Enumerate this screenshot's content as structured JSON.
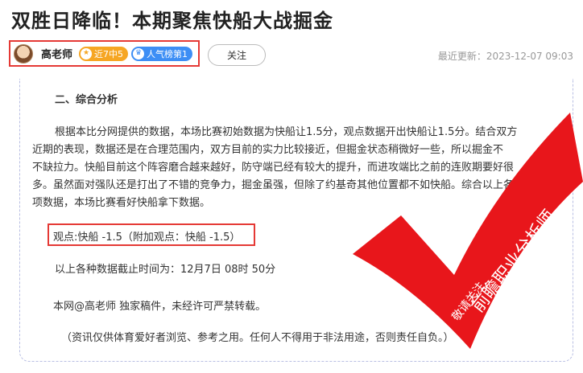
{
  "article": {
    "title": "双胜日降临！本期聚焦快船大战掘金",
    "update_time": "最近更新：2023-12-07 09:03"
  },
  "author": {
    "name": "高老师",
    "badges": [
      {
        "label": "近7中5",
        "icon": "star-icon",
        "color": "#f6a623"
      },
      {
        "label": "人气榜第1",
        "icon": "crown-icon",
        "color": "#3d8ef5"
      }
    ],
    "follow_label": "关注"
  },
  "content": {
    "section_heading": "二、综合分析",
    "paragraph_lines": [
      "根据本比分网提供的数据，本场比赛初始数据为快船让1.5分，观点数据开出快船让1.5分。结合双方",
      "近期的表现，数据还是在合理范围内，双方目前的实力比较接近，但掘金状态稍微好一些，所以掘金不",
      "不缺拉力。快船目前这个阵容磨合越来越好，防守端已经有较大的提升，而进攻端比之前的连败期要好很",
      "多。虽然面对强队还是打出了不错的竞争力，掘金虽强，但除了约基奇其他位置都不如快船。综合以上各",
      "项数据，本场比赛看好快船拿下数据。"
    ],
    "opinion": "观点:快船 -1.5（附加观点：快船 -1.5）",
    "cutoff_time": "以上各种数据截止时间为：12月7日  08时 50分",
    "copyright": "本网@高老师 独家稿件，未经许可严禁转载。",
    "disclaimer": "（资讯仅供体育爱好者浏览、参考之用。任何人不得用于非法用途，否则责任自负。）"
  },
  "stamp": {
    "text_small": "敬请关注",
    "text_large": "前瞻职业分析师",
    "color": "#e8161b"
  }
}
